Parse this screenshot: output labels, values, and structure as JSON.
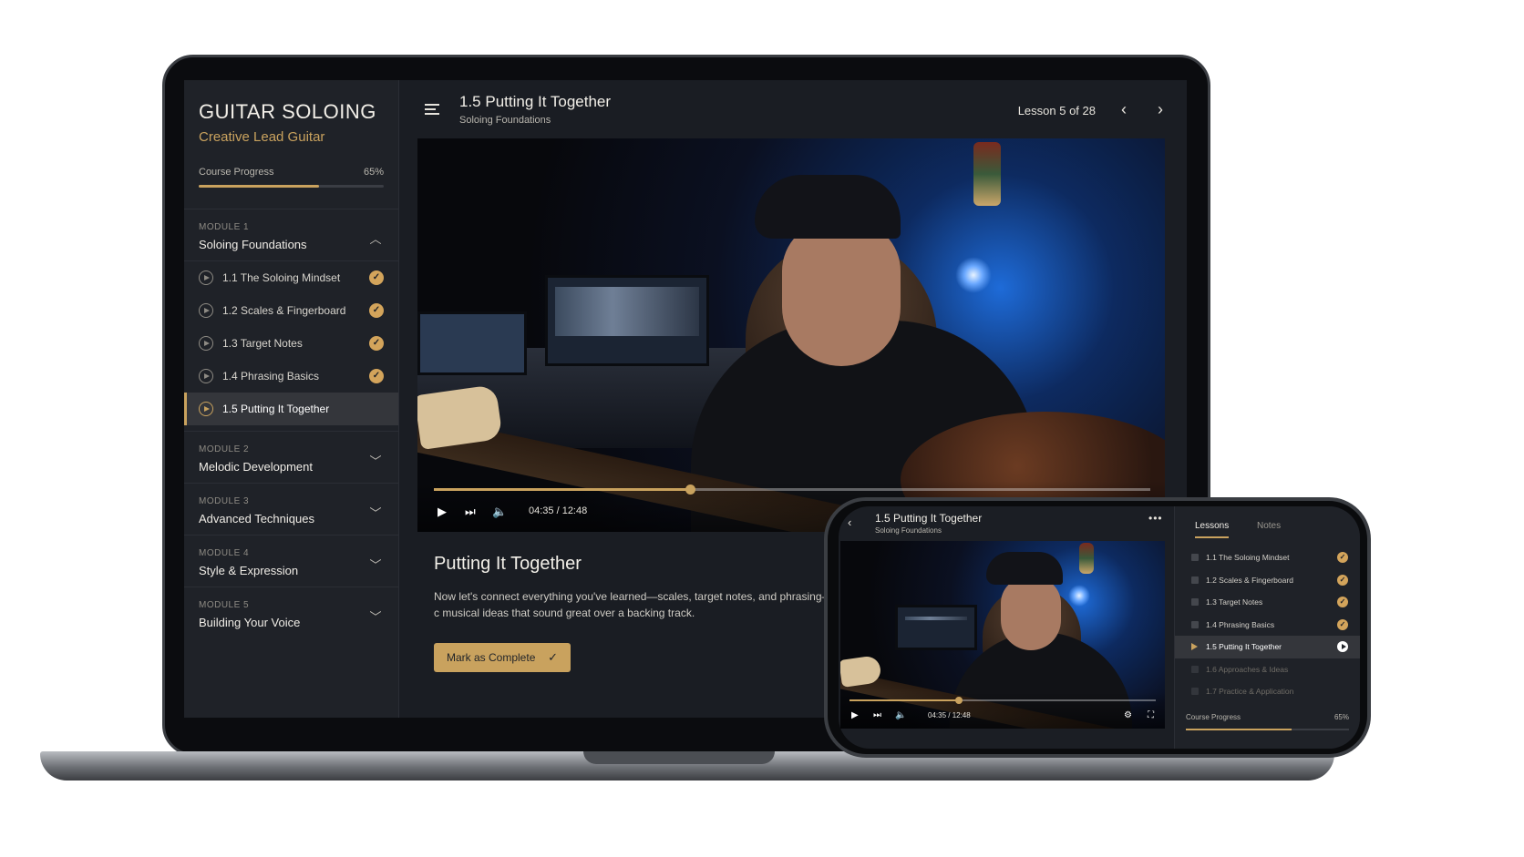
{
  "course": {
    "title": "GUITAR SOLOING",
    "subtitle": "Creative Lead Guitar",
    "progress_label": "Course Progress",
    "progress_text": "65%",
    "progress_value": 0.65
  },
  "modules": [
    {
      "number": "MODULE 1",
      "title": "Soloing Foundations",
      "expanded": true,
      "lessons": [
        {
          "label": "1.1  The Soloing Mindset",
          "status": "complete"
        },
        {
          "label": "1.2  Scales & Fingerboard",
          "status": "complete"
        },
        {
          "label": "1.3  Target Notes",
          "status": "complete"
        },
        {
          "label": "1.4  Phrasing Basics",
          "status": "complete"
        },
        {
          "label": "1.5  Putting It Together",
          "status": "active"
        }
      ]
    },
    {
      "number": "MODULE 2",
      "title": "Melodic Development",
      "expanded": false
    },
    {
      "number": "MODULE 3",
      "title": "Advanced Techniques",
      "expanded": false
    },
    {
      "number": "MODULE 4",
      "title": "Style & Expression",
      "expanded": false
    },
    {
      "number": "MODULE 5",
      "title": "Building Your Voice",
      "expanded": false
    }
  ],
  "header": {
    "title": "1.5 Putting It Together",
    "subtitle": "Soloing Foundations",
    "lesson_count": "Lesson 5 of 28"
  },
  "player": {
    "time": "04:35 / 12:48",
    "progress_value": 0.358
  },
  "content": {
    "title": "Putting It Together",
    "description": "Now let's connect everything you've learned—scales, target notes, and phrasing—into c musical ideas that sound great over a backing track.",
    "complete_label": "Mark as Complete"
  },
  "phone": {
    "title": "1.5 Putting It Together",
    "subtitle": "Soloing Foundations",
    "time": "04:35 / 12:48",
    "tabs": [
      "Lessons",
      "Notes"
    ],
    "lessons": [
      {
        "label": "1.1 The Soloing Mindset",
        "status": "complete"
      },
      {
        "label": "1.2 Scales & Fingerboard",
        "status": "complete"
      },
      {
        "label": "1.3 Target Notes",
        "status": "complete"
      },
      {
        "label": "1.4 Phrasing Basics",
        "status": "complete"
      },
      {
        "label": "1.5 Putting It Together",
        "status": "active"
      },
      {
        "label": "1.6 Approaches & Ideas",
        "status": "locked"
      },
      {
        "label": "1.7 Practice & Application",
        "status": "locked"
      }
    ],
    "progress_label": "Course Progress",
    "progress_text": "65%"
  },
  "icons": {
    "menu": "menu-icon",
    "prev": "chevron-left-icon",
    "next": "chevron-right-icon",
    "play": "play-icon",
    "skip": "skip-next-icon",
    "volume": "volume-icon",
    "settings": "gear-icon",
    "fullscreen": "fullscreen-icon",
    "check": "check-icon"
  },
  "colors": {
    "accent": "#c9a25e",
    "background": "#1a1d23",
    "sidebar": "#1f2228"
  }
}
